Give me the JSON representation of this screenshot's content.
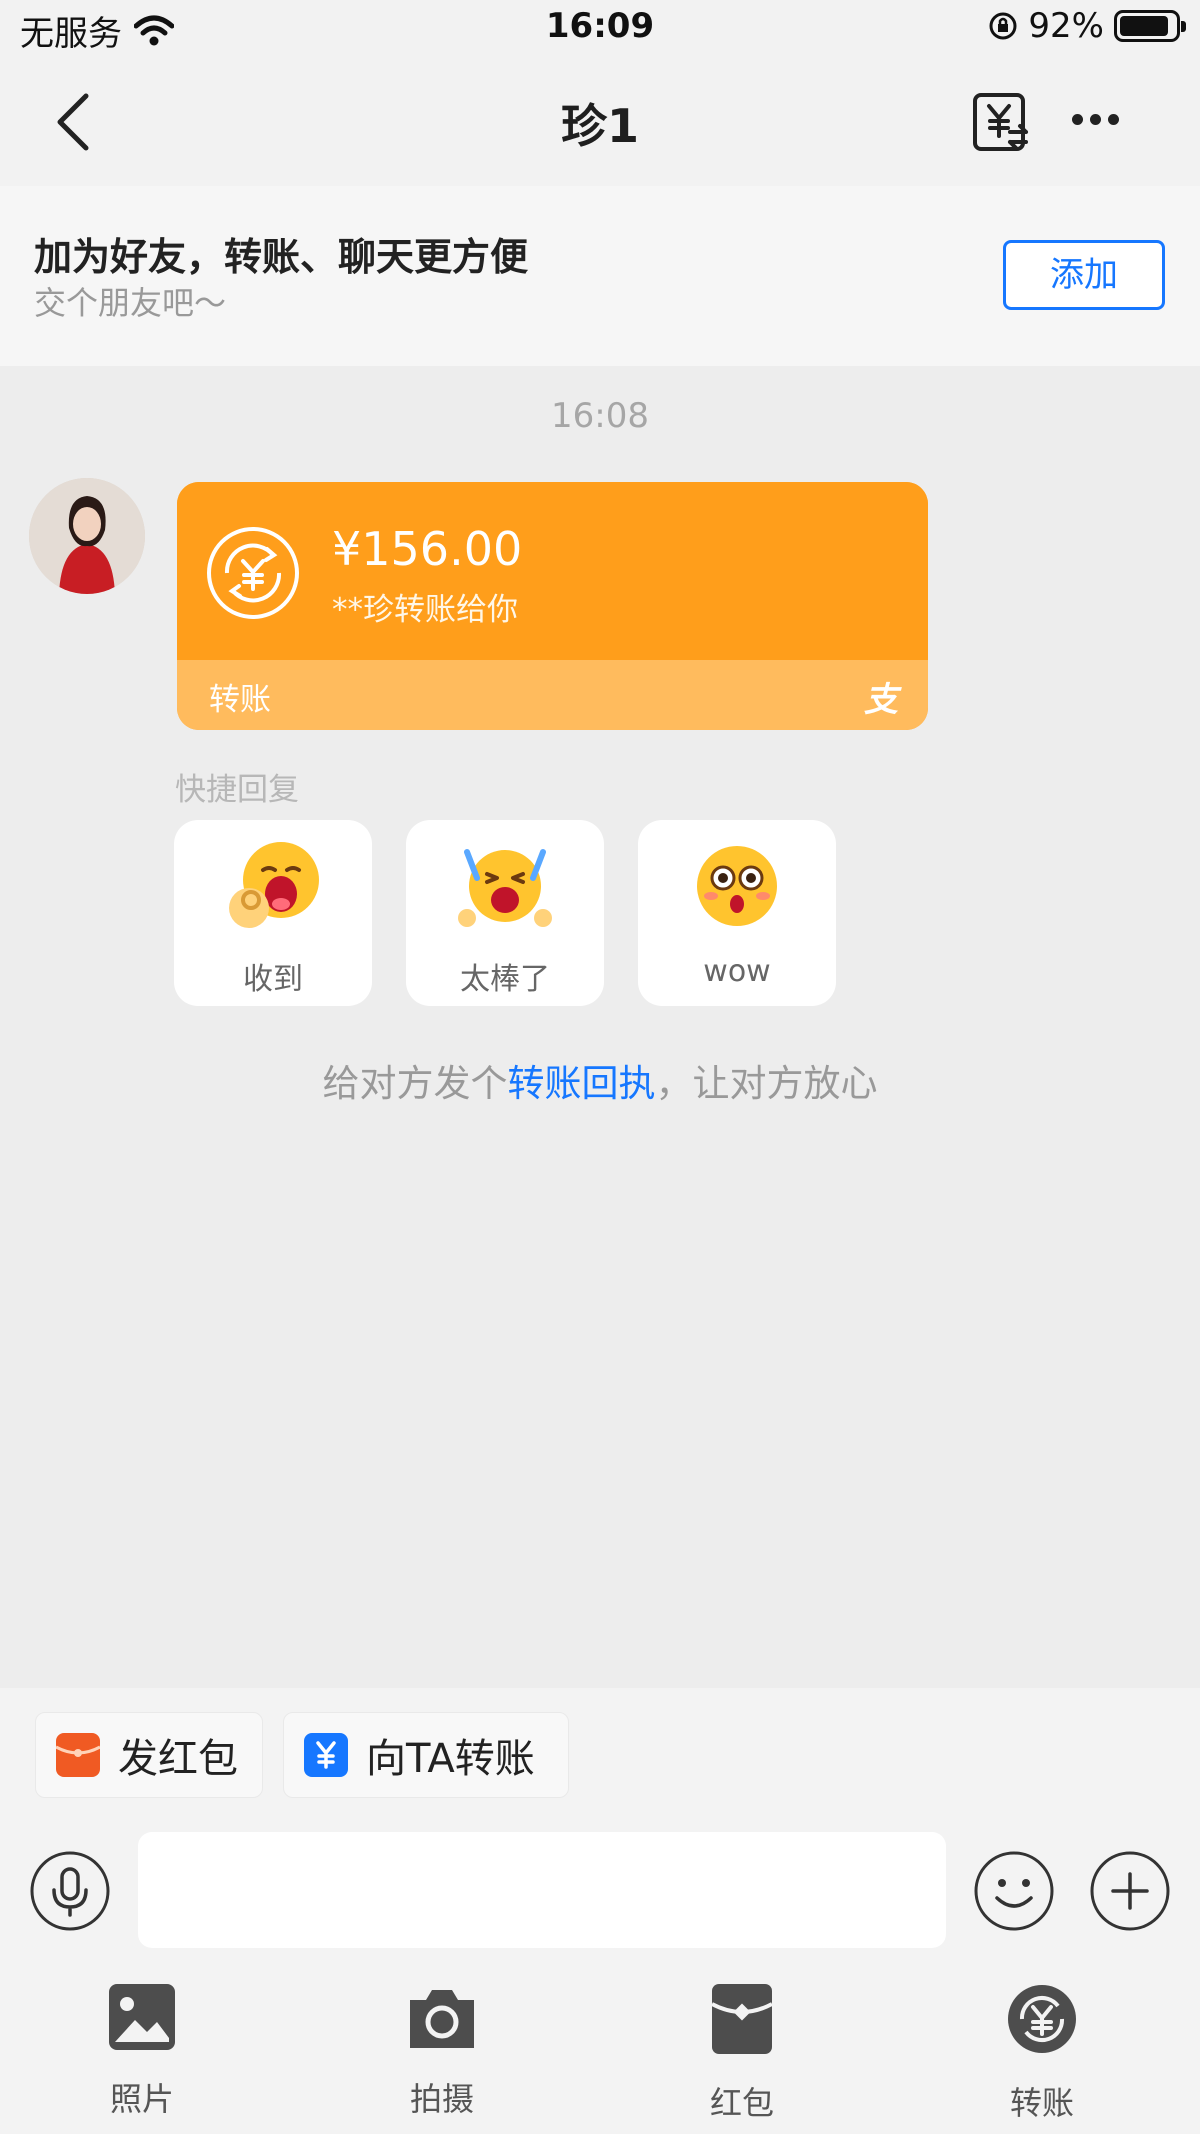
{
  "status_bar": {
    "carrier": "无服务",
    "time": "16:09",
    "battery": "92%"
  },
  "nav": {
    "title": "珍1"
  },
  "friend_bar": {
    "title": "加为好友，转账、聊天更方便",
    "subtitle": "交个朋友吧～",
    "add_label": "添加"
  },
  "chat": {
    "timestamp": "16:08",
    "transfer": {
      "amount": "¥156.00",
      "note": "**珍转账给你",
      "label": "转账",
      "logo": "支"
    }
  },
  "quick_reply": {
    "label": "快捷回复",
    "items": [
      {
        "label": "收到",
        "emoji": "ok-hand-emoji"
      },
      {
        "label": "太棒了",
        "emoji": "cheering-emoji"
      },
      {
        "label": "wow",
        "emoji": "surprised-emoji"
      }
    ]
  },
  "hint": {
    "prefix": "给对方发个",
    "link": "转账回执",
    "suffix": "，让对方放心"
  },
  "chips": {
    "red_packet": "发红包",
    "transfer": "向TA转账"
  },
  "toolbar": {
    "items": [
      {
        "label": "照片",
        "icon": "photo-icon"
      },
      {
        "label": "拍摄",
        "icon": "camera-icon"
      },
      {
        "label": "红包",
        "icon": "red-packet-icon"
      },
      {
        "label": "转账",
        "icon": "transfer-icon"
      }
    ]
  },
  "colors": {
    "accent": "#1677ff",
    "card_orange": "#ff9e1b",
    "card_light": "#ffbb5d",
    "red_packet": "#f05a23"
  }
}
